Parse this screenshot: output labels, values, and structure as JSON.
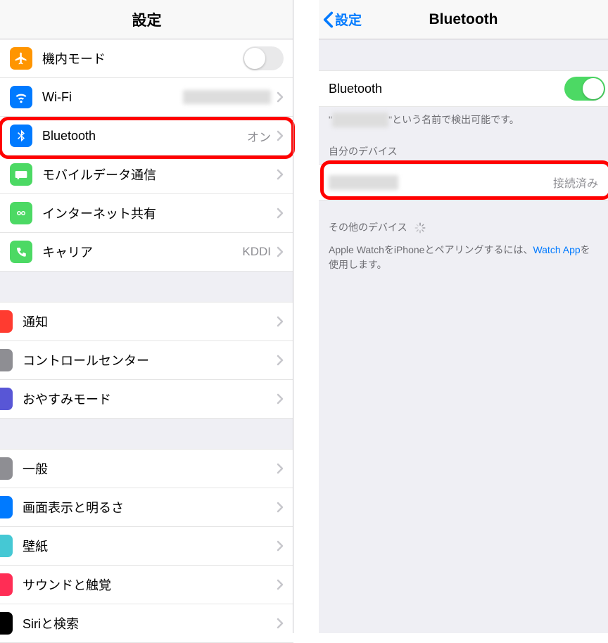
{
  "left": {
    "title": "設定",
    "rows": [
      {
        "key": "airplane",
        "label": "機内モード",
        "iconClass": "ic-orange",
        "value": "",
        "toggle": "off"
      },
      {
        "key": "wifi",
        "label": "Wi-Fi",
        "iconClass": "ic-blue",
        "value": "",
        "chev": true,
        "redactVal": true
      },
      {
        "key": "bluetooth",
        "label": "Bluetooth",
        "iconClass": "ic-blue",
        "value": "オン",
        "chev": true,
        "highlight": true
      },
      {
        "key": "cellular",
        "label": "モバイルデータ通信",
        "iconClass": "ic-green",
        "value": "",
        "chev": true
      },
      {
        "key": "hotspot",
        "label": "インターネット共有",
        "iconClass": "ic-green",
        "value": "",
        "chev": true
      },
      {
        "key": "carrier",
        "label": "キャリア",
        "iconClass": "ic-green",
        "value": "KDDI",
        "chev": true
      }
    ],
    "group2": [
      {
        "key": "notifications",
        "label": "通知",
        "iconClass": "ic-red",
        "chev": true
      },
      {
        "key": "controlcenter",
        "label": "コントロールセンター",
        "iconClass": "ic-gray",
        "chev": true
      },
      {
        "key": "dnd",
        "label": "おやすみモード",
        "iconClass": "ic-purple",
        "chev": true
      }
    ],
    "group3": [
      {
        "key": "general",
        "label": "一般",
        "iconClass": "ic-gray",
        "chev": true
      },
      {
        "key": "display",
        "label": "画面表示と明るさ",
        "iconClass": "ic-blue",
        "chev": true
      },
      {
        "key": "wallpaper",
        "label": "壁紙",
        "iconClass": "ic-teal",
        "chev": true
      },
      {
        "key": "sounds",
        "label": "サウンドと触覚",
        "iconClass": "ic-pink",
        "chev": true
      },
      {
        "key": "siri",
        "label": "Siriと検索",
        "iconClass": "ic-black",
        "chev": true
      }
    ]
  },
  "right": {
    "back": "設定",
    "title": "Bluetooth",
    "toggleLabel": "Bluetooth",
    "discoverable_prefix": "\"",
    "discoverable_name_redacted": "██████",
    "discoverable_suffix": "\"という名前で検出可能です。",
    "my_devices_header": "自分のデバイス",
    "my_device_name_redacted": "██████",
    "my_device_status": "接続済み",
    "other_devices_header": "その他のデバイス",
    "pair_text_before": "Apple WatchをiPhoneとペアリングするには、",
    "pair_link": "Watch App",
    "pair_text_after": "を使用します。"
  }
}
